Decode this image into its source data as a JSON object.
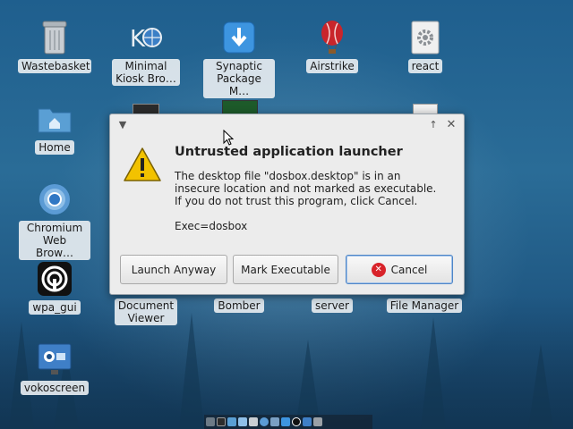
{
  "desktop": {
    "icons": [
      {
        "id": "wastebasket",
        "label": "Wastebasket",
        "icon": "trash-icon"
      },
      {
        "id": "minimal-kiosk",
        "label": "Minimal\nKiosk Bro…",
        "icon": "kiosk-browser-icon"
      },
      {
        "id": "synaptic",
        "label": "Synaptic\nPackage M…",
        "icon": "synaptic-icon"
      },
      {
        "id": "airstrike",
        "label": "Airstrike",
        "icon": "balloon-icon"
      },
      {
        "id": "react",
        "label": "react",
        "icon": "gear-file-icon"
      },
      {
        "id": "home",
        "label": "Home",
        "icon": "home-folder-icon"
      },
      {
        "id": "chromium",
        "label": "Chromium\nWeb Brow…",
        "icon": "chromium-icon"
      },
      {
        "id": "wpa-gui",
        "label": "wpa_gui",
        "icon": "wifi-icon"
      },
      {
        "id": "document-viewer",
        "label": "Document\nViewer",
        "icon": "document-viewer-icon"
      },
      {
        "id": "bomber",
        "label": "Bomber",
        "icon": "bomber-icon"
      },
      {
        "id": "server",
        "label": "server",
        "icon": "server-icon"
      },
      {
        "id": "file-manager",
        "label": "File Manager",
        "icon": "file-manager-icon"
      },
      {
        "id": "vokoscreen",
        "label": "vokoscreen",
        "icon": "vokoscreen-icon"
      }
    ]
  },
  "dialog": {
    "title": "Untrusted application launcher",
    "message_lines": [
      "The desktop file \"dosbox.desktop\" is in an",
      "insecure location and not marked as executable.",
      "If you do not trust this program, click Cancel."
    ],
    "exec": "Exec=dosbox",
    "buttons": {
      "launch": "Launch Anyway",
      "mark": "Mark Executable",
      "cancel": "Cancel"
    },
    "icon": "warning-icon"
  },
  "colors": {
    "desktop": "#2a6c97",
    "dialog_bg": "#ececec",
    "warning": "#f2c200",
    "cancel": "#d8232a",
    "focus": "#4f86c6"
  }
}
